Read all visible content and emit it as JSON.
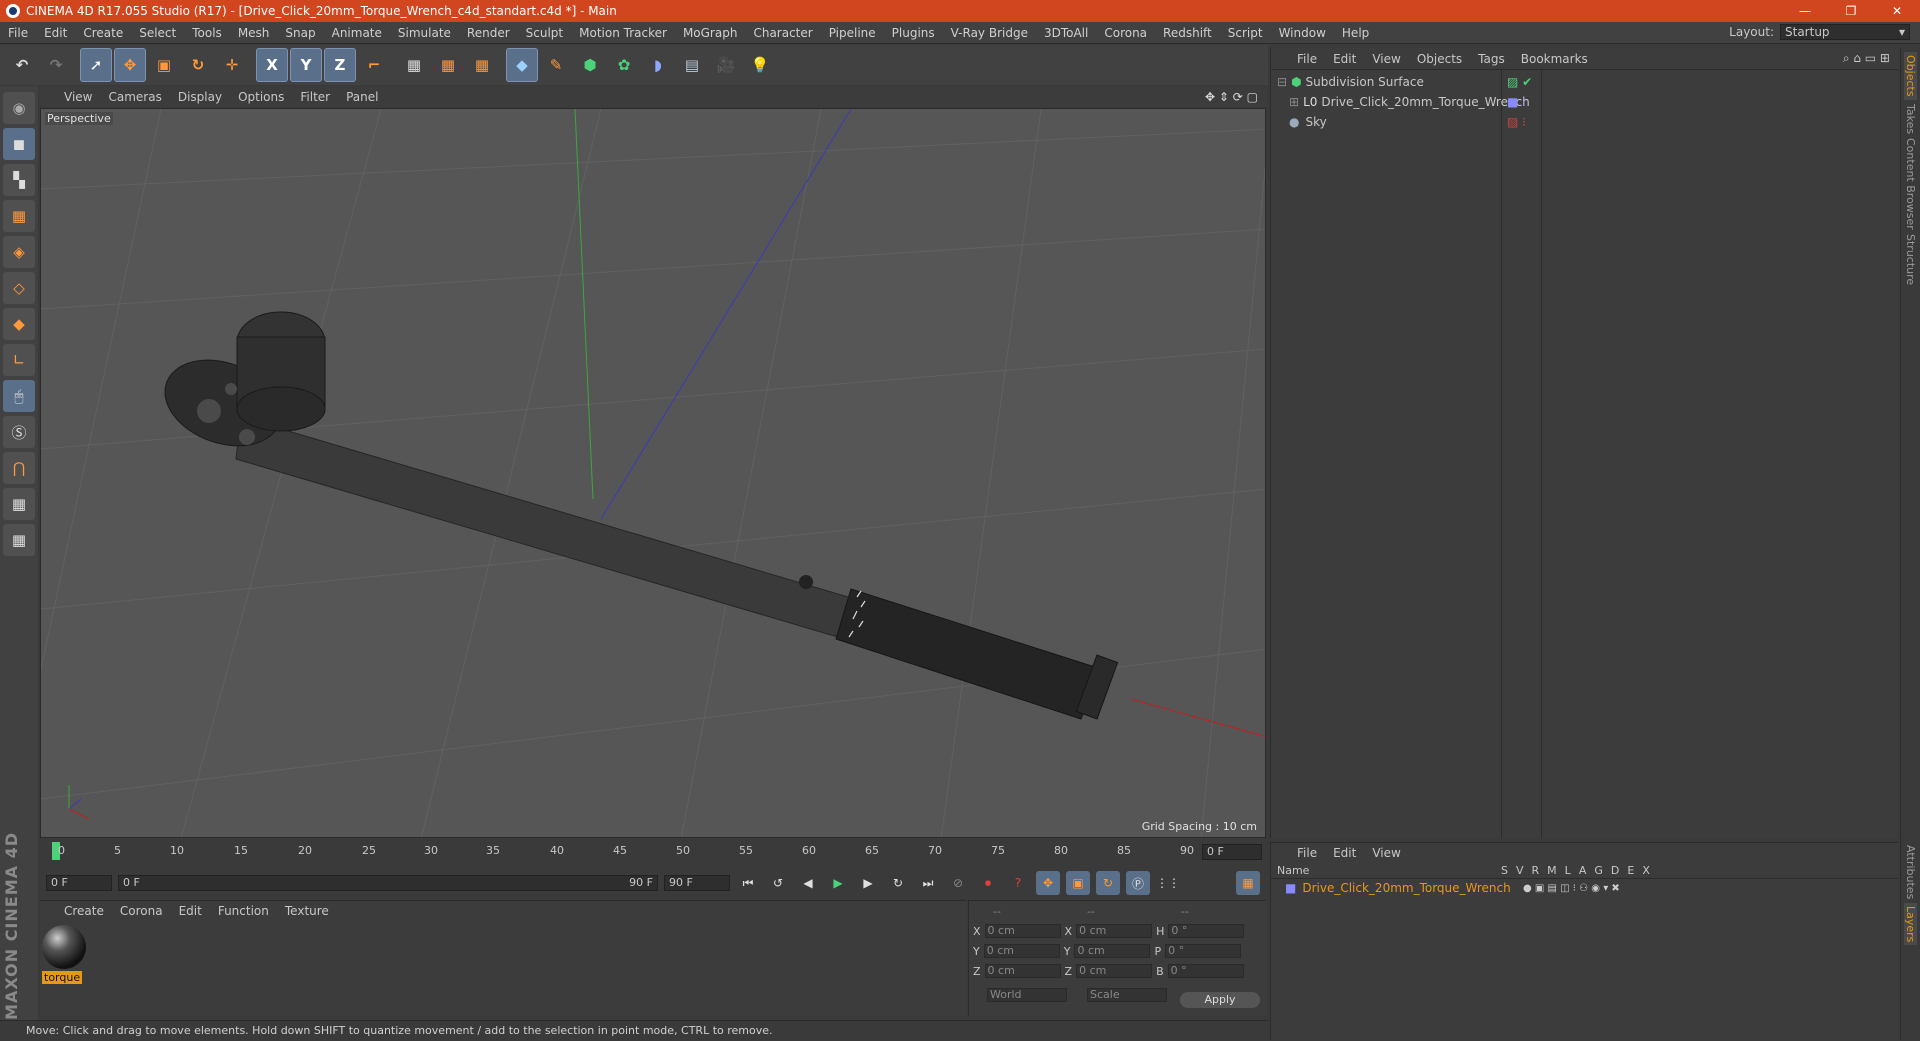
{
  "window": {
    "title": "CINEMA 4D R17.055 Studio (R17) - [Drive_Click_20mm_Torque_Wrench_c4d_standart.c4d *] - Main",
    "buttons": [
      "—",
      "❐",
      "✕"
    ]
  },
  "menubar": {
    "items": [
      "File",
      "Edit",
      "Create",
      "Select",
      "Tools",
      "Mesh",
      "Snap",
      "Animate",
      "Simulate",
      "Render",
      "Sculpt",
      "Motion Tracker",
      "MoGraph",
      "Character",
      "Pipeline",
      "Plugins",
      "V-Ray Bridge",
      "3DToAll",
      "Corona",
      "Redshift",
      "Script",
      "Window",
      "Help"
    ],
    "layout_label": "Layout:",
    "layout_value": "Startup"
  },
  "toolbar": {
    "icons": [
      "undo-icon",
      "redo-icon",
      "select-icon",
      "move-icon",
      "scale-icon",
      "rotate-icon",
      "transform-icon",
      "x-axis-icon",
      "y-axis-icon",
      "z-axis-icon",
      "coordinate-system-icon",
      "render-view-icon",
      "render-region-icon",
      "render-settings-icon",
      "cube-icon",
      "pen-icon",
      "subdivision-icon",
      "cloner-icon",
      "deformer-icon",
      "floor-icon",
      "camera-icon",
      "light-icon"
    ],
    "axis_labels": [
      "X",
      "Y",
      "Z"
    ]
  },
  "viewport": {
    "menu": [
      "View",
      "Cameras",
      "Display",
      "Options",
      "Filter",
      "Panel"
    ],
    "label": "Perspective",
    "grid_spacing": "Grid Spacing : 10 cm"
  },
  "timeline": {
    "ticks": [
      "0",
      "5",
      "10",
      "15",
      "20",
      "25",
      "30",
      "35",
      "40",
      "45",
      "50",
      "55",
      "60",
      "65",
      "70",
      "75",
      "80",
      "85",
      "90"
    ],
    "current_frame": "0 F",
    "start_field": "0 F",
    "range_start": "0 F",
    "range_end": "90 F",
    "end_field": "90 F"
  },
  "material_manager": {
    "menu": [
      "Create",
      "Corona",
      "Edit",
      "Function",
      "Texture"
    ],
    "material_name": "torque"
  },
  "coordinates": {
    "headers": [
      "--",
      "--",
      "--"
    ],
    "rows": [
      {
        "a": "X",
        "v1": "0 cm",
        "b": "X",
        "v2": "0 cm",
        "c": "H",
        "v3": "0 °"
      },
      {
        "a": "Y",
        "v1": "0 cm",
        "b": "Y",
        "v2": "0 cm",
        "c": "P",
        "v3": "0 °"
      },
      {
        "a": "Z",
        "v1": "0 cm",
        "b": "Z",
        "v2": "0 cm",
        "c": "B",
        "v3": "0 °"
      }
    ],
    "world": "World",
    "scale": "Scale",
    "apply": "Apply"
  },
  "status": "Move: Click and drag to move elements. Hold down SHIFT to quantize movement / add to the selection in point mode, CTRL to remove.",
  "object_manager": {
    "menu": [
      "File",
      "Edit",
      "View",
      "Objects",
      "Tags",
      "Bookmarks"
    ],
    "objects": [
      {
        "name": "Subdivision Surface",
        "color": "#4cd37a"
      },
      {
        "name": "Drive_Click_20mm_Torque_Wrench",
        "color": "#c8c8c8"
      },
      {
        "name": "Sky",
        "color": "#c8c8c8"
      }
    ]
  },
  "layer_manager": {
    "menu": [
      "File",
      "Edit",
      "View"
    ],
    "columns": [
      "Name",
      "S",
      "V",
      "R",
      "M",
      "L",
      "A",
      "G",
      "D",
      "E",
      "X"
    ],
    "layer_name": "Drive_Click_20mm_Torque_Wrench"
  },
  "right_tabs": [
    "Objects",
    "Takes",
    "Content Browser",
    "Structure",
    "Attributes",
    "Layers"
  ],
  "maxon_logo": "MAXON CINEMA 4D"
}
